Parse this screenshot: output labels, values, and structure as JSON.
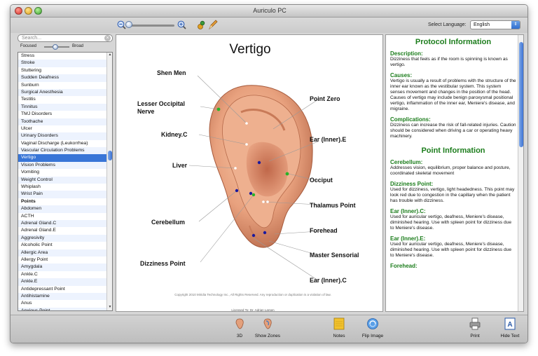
{
  "window": {
    "title": "Auriculo PC"
  },
  "toolbar": {
    "select_language_label": "Select Language:",
    "language_value": "English"
  },
  "search": {
    "placeholder": "Search..."
  },
  "focus_slider": {
    "left_label": "Focused",
    "right_label": "Broad"
  },
  "list_items": [
    {
      "label": "Stress"
    },
    {
      "label": "Stroke"
    },
    {
      "label": "Stuttering"
    },
    {
      "label": "Sudden Deafness"
    },
    {
      "label": "Sunburn"
    },
    {
      "label": "Surgical Anesthesia"
    },
    {
      "label": "Testitis"
    },
    {
      "label": "Tinnitus"
    },
    {
      "label": "TMJ Disorders"
    },
    {
      "label": "Toothache"
    },
    {
      "label": "Ulcer"
    },
    {
      "label": "Urinary Disorders"
    },
    {
      "label": "Vaginal Discharge (Leukorrhea)"
    },
    {
      "label": "Vascular Circulation Problems"
    },
    {
      "label": "Vertigo",
      "selected": true
    },
    {
      "label": "Vision Problems"
    },
    {
      "label": "Vomiting"
    },
    {
      "label": "Weight Control"
    },
    {
      "label": "Whiplash"
    },
    {
      "label": "Wrist Pain"
    },
    {
      "label": "Points",
      "header": true
    },
    {
      "label": "Abdomen"
    },
    {
      "label": "ACTH"
    },
    {
      "label": "Adrenal Gland.C"
    },
    {
      "label": "Adrenal Gland.E"
    },
    {
      "label": "Aggresivity"
    },
    {
      "label": "Alcoholic Point"
    },
    {
      "label": "Allergic Area"
    },
    {
      "label": "Allergy Point"
    },
    {
      "label": "Amygdala"
    },
    {
      "label": "Ankle.C"
    },
    {
      "label": "Ankle.E"
    },
    {
      "label": "Antidepressant Point"
    },
    {
      "label": "Antihistamine"
    },
    {
      "label": "Anus"
    },
    {
      "label": "Anxious Point"
    }
  ],
  "diagram": {
    "title": "Vertigo",
    "labels": {
      "shen_men": "Shen Men",
      "lesser_occipital": "Lesser Occipital\nNerve",
      "kidney_c": "Kidney.C",
      "liver": "Liver",
      "cerebellum": "Cerebellum",
      "dizziness_point": "Dizziness Point",
      "point_zero": "Point Zero",
      "ear_inner_e": "Ear (Inner).E",
      "occiput": "Occiput",
      "thalamus_point": "Thalamus Point",
      "forehead": "Forehead",
      "master_sensorial": "Master Sensorial",
      "ear_inner_c": "Ear (Inner).C"
    },
    "copyright": "Copyright 2010 Miridia Technology Inc., All Rights Reserved. Any reproduction or duplication is a violation of law.",
    "licensed": "Licensed To: Dr. Adrian Larsen"
  },
  "protocol": {
    "heading": "Protocol Information",
    "description_title": "Description:",
    "description": "Dizziness that feels as if the room is spinning is known as vertigo.",
    "causes_title": "Causes:",
    "causes": "Vertigo is usually a result of problems with the structure of the inner ear known as the vestibular system. This system senses movement and changes in the position of the head. Causes of vertigo may include benign paroxysmal positional vertigo, inflammation of the inner ear, Meniere's disease, and migraine.",
    "complications_title": "Complications:",
    "complications": "Dizziness can increase the risk of fall-related injuries. Caution should be considered when driving a car or operating heavy machinery."
  },
  "point_info": {
    "heading": "Point Information",
    "items": [
      {
        "title": "Cerebellum:",
        "text": "Addresses vision, equilibrium, proper balance and posture, coordinated skeletal movement"
      },
      {
        "title": "Dizziness Point:",
        "text": "Used for dizziness, vertigo, light headedness. This point may look red due to congestion in the capillary when the patient has trouble with dizziness."
      },
      {
        "title": "Ear (Inner).C:",
        "text": "Used for auricular vertigo, deafness, Meniere's disease, diminished hearing. Use with spleen point for dizziness due to Meniere's disease."
      },
      {
        "title": "Ear (Inner).E:",
        "text": "Used for auricular vertigo, deafness, Meniere's disease, diminished hearing. Use with spleen point for dizziness due to Meniere's disease."
      },
      {
        "title": "Forehead:",
        "text": ""
      }
    ]
  },
  "bottom": {
    "btn_3d": "3D",
    "btn_zones": "Show Zones",
    "btn_notes": "Notes",
    "btn_flip": "Flip Image",
    "btn_print": "Print",
    "btn_hide": "Hide Text"
  },
  "colors": {
    "selection": "#3875d7",
    "green_heading": "#1c7d1c",
    "point_blue": "#1a1a9e",
    "point_green": "#28b428"
  }
}
